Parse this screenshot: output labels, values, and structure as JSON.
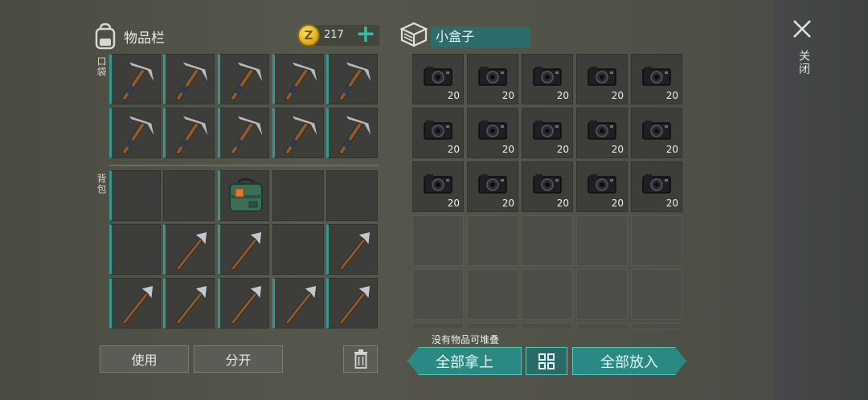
{
  "inventory": {
    "title": "物品栏",
    "coins": "217",
    "pocket_label": "口袋",
    "backpack_label": "背包",
    "use_button": "使用",
    "split_button": "分开"
  },
  "pocket_slots": [
    "pickaxe",
    "pickaxe",
    "pickaxe",
    "pickaxe",
    "pickaxe",
    "pickaxe",
    "pickaxe",
    "pickaxe",
    "pickaxe",
    "pickaxe"
  ],
  "backpack_slots": [
    "",
    "",
    "supply-bag",
    "",
    "",
    "",
    "spear",
    "spear",
    "",
    "spear",
    "spear",
    "spear",
    "spear",
    "spear",
    "spear"
  ],
  "box": {
    "title": "小盒子",
    "items": [
      {
        "item": "camera",
        "qty": "20"
      },
      {
        "item": "camera",
        "qty": "20"
      },
      {
        "item": "camera",
        "qty": "20"
      },
      {
        "item": "camera",
        "qty": "20"
      },
      {
        "item": "camera",
        "qty": "20"
      },
      {
        "item": "camera",
        "qty": "20"
      },
      {
        "item": "camera",
        "qty": "20"
      },
      {
        "item": "camera",
        "qty": "20"
      },
      {
        "item": "camera",
        "qty": "20"
      },
      {
        "item": "camera",
        "qty": "20"
      },
      {
        "item": "camera",
        "qty": "20"
      },
      {
        "item": "camera",
        "qty": "20"
      },
      {
        "item": "camera",
        "qty": "20"
      },
      {
        "item": "camera",
        "qty": "20"
      },
      {
        "item": "camera",
        "qty": "20"
      }
    ],
    "stack_note": "没有物品可堆叠",
    "take_all": "全部拿上",
    "put_all": "全部放入"
  },
  "close_label": "关闭",
  "colors": {
    "accent": "#2e9a91",
    "button_teal": "#2a8a83",
    "coin": "#e6b320"
  }
}
